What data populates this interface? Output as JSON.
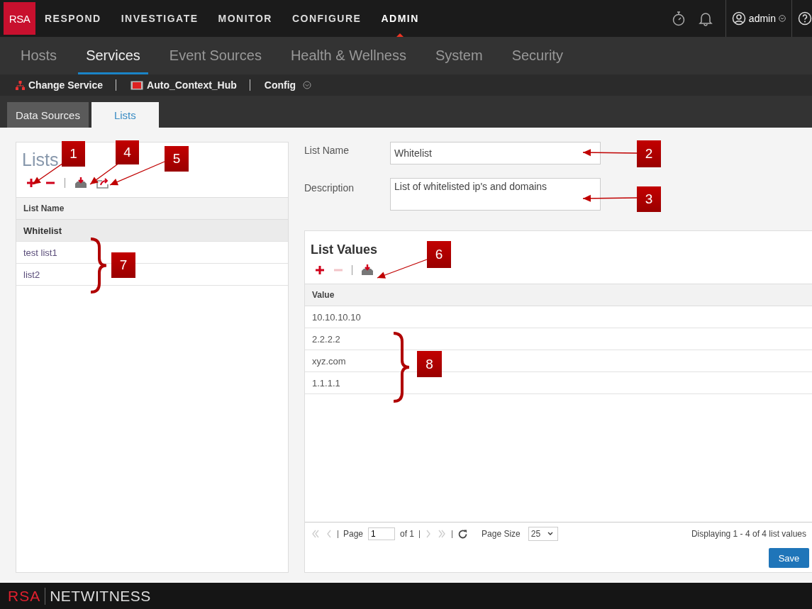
{
  "top_nav": {
    "logo": "RSA",
    "items": [
      {
        "label": "RESPOND",
        "selected": false
      },
      {
        "label": "INVESTIGATE",
        "selected": false
      },
      {
        "label": "MONITOR",
        "selected": false
      },
      {
        "label": "CONFIGURE",
        "selected": false
      },
      {
        "label": "ADMIN",
        "selected": true
      }
    ],
    "user": "admin"
  },
  "sub_nav": [
    {
      "label": "Hosts",
      "selected": false
    },
    {
      "label": "Services",
      "selected": true
    },
    {
      "label": "Event Sources",
      "selected": false
    },
    {
      "label": "Health & Wellness",
      "selected": false
    },
    {
      "label": "System",
      "selected": false
    },
    {
      "label": "Security",
      "selected": false
    }
  ],
  "toolbar": {
    "change_service": "Change Service",
    "service": "Auto_Context_Hub",
    "config": "Config"
  },
  "tabs": [
    {
      "label": "Data Sources",
      "selected": false
    },
    {
      "label": "Lists",
      "selected": true
    }
  ],
  "lists_panel": {
    "title": "Lists",
    "column": "List Name",
    "rows": [
      {
        "name": "Whitelist",
        "selected": true
      },
      {
        "name": "test list1",
        "selected": false
      },
      {
        "name": "list2",
        "selected": false
      }
    ]
  },
  "form": {
    "list_name_label": "List Name",
    "list_name": "Whitelist",
    "description_label": "Description",
    "description": "List of whitelisted ip's and domains"
  },
  "values_panel": {
    "title": "List Values",
    "remove_disabled": true,
    "column": "Value",
    "rows": [
      "10.10.10.10",
      "2.2.2.2",
      "xyz.com",
      "1.1.1.1"
    ],
    "pager": {
      "page_label": "Page",
      "page": "1",
      "of": "of 1",
      "page_size_label": "Page Size",
      "page_size": "25",
      "display": "Displaying 1 - 4 of 4 list values"
    },
    "save": "Save"
  },
  "callouts": [
    {
      "label": "1",
      "kind": "arrow"
    },
    {
      "label": "4",
      "kind": "arrow"
    },
    {
      "label": "5",
      "kind": "arrow"
    },
    {
      "label": "2",
      "kind": "arrow"
    },
    {
      "label": "3",
      "kind": "arrow"
    },
    {
      "label": "6",
      "kind": "arrow"
    },
    {
      "label": "7",
      "kind": "brace"
    },
    {
      "label": "8",
      "kind": "brace"
    }
  ],
  "footer": {
    "brand": "RSA",
    "product": "NETWITNESS"
  }
}
